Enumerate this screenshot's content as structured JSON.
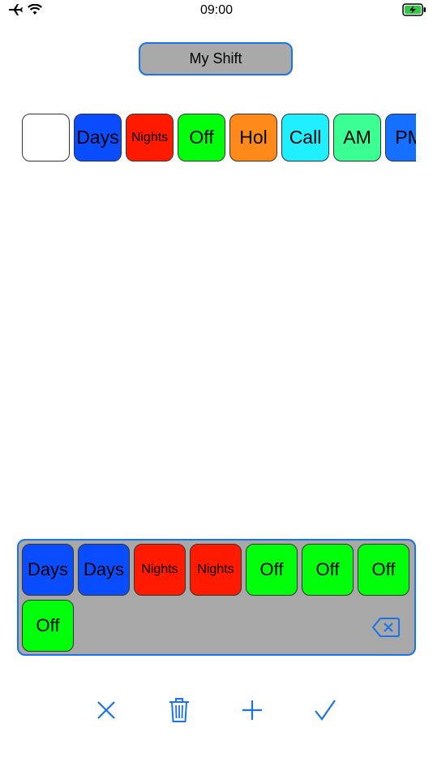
{
  "status": {
    "time": "09:00"
  },
  "title": {
    "label": "My Shift"
  },
  "palette": [
    {
      "label": "",
      "color": "#ffffff"
    },
    {
      "label": "Days",
      "color": "#0a4dff"
    },
    {
      "label": "Nights",
      "color": "#ff1a00"
    },
    {
      "label": "Off",
      "color": "#00ff0a"
    },
    {
      "label": "Hol",
      "color": "#ff8a1a"
    },
    {
      "label": "Call",
      "color": "#1fefff"
    },
    {
      "label": "AM",
      "color": "#3cff94"
    },
    {
      "label": "PM",
      "color": "#1670ff"
    }
  ],
  "sequence": [
    {
      "label": "Days",
      "color": "#0a4dff"
    },
    {
      "label": "Days",
      "color": "#0a4dff"
    },
    {
      "label": "Nights",
      "color": "#ff1a00"
    },
    {
      "label": "Nights",
      "color": "#ff1a00"
    },
    {
      "label": "Off",
      "color": "#00ff0a"
    },
    {
      "label": "Off",
      "color": "#00ff0a"
    },
    {
      "label": "Off",
      "color": "#00ff0a"
    },
    {
      "label": "Off",
      "color": "#00ff0a"
    }
  ],
  "toolbar": {
    "icons": [
      "close-icon",
      "trash-icon",
      "plus-icon",
      "checkmark-icon"
    ],
    "tint": "#1a73e8"
  }
}
